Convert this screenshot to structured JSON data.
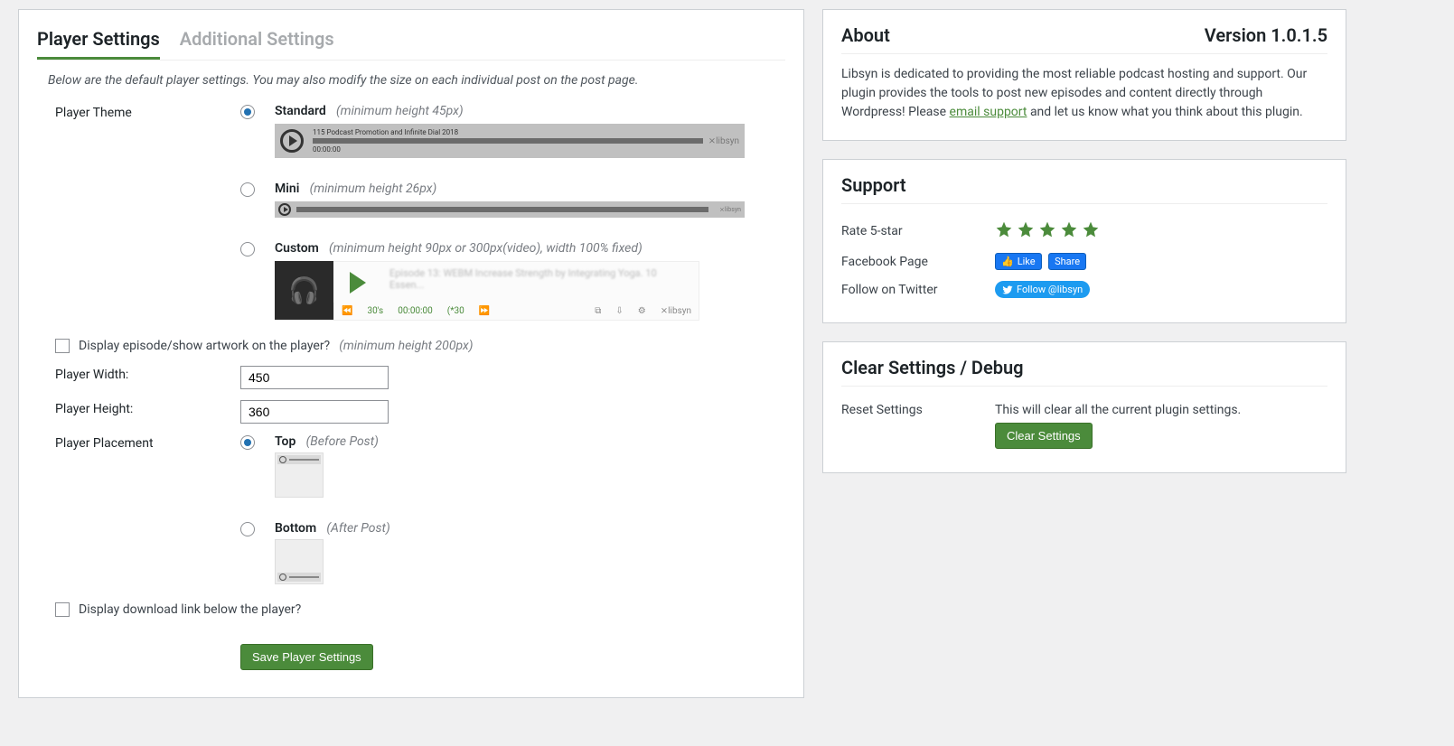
{
  "tabs": {
    "player_settings": "Player Settings",
    "additional_settings": "Additional Settings"
  },
  "intro": "Below are the default player settings. You may also modify the size on each individual post on the post page.",
  "player_theme": {
    "label": "Player Theme",
    "standard": {
      "label": "Standard",
      "note": "(minimum height 45px)",
      "track_title": "115 Podcast Promotion and Infinite Dial 2018",
      "time": "00:00:00"
    },
    "mini": {
      "label": "Mini",
      "note": "(minimum height 26px)"
    },
    "custom": {
      "label": "Custom",
      "note": "(minimum height 90px or 300px(video), width 100% fixed)",
      "blur_text": "Episode 13: WEBM Increase Strength by Integrating Yoga. 10 Essen...",
      "t1": "30's",
      "t2": "00:00:00",
      "t3": "(*30"
    }
  },
  "artwork_checkbox": {
    "label": "Display episode/show artwork on the player?",
    "note": "(minimum height 200px)"
  },
  "player_width": {
    "label": "Player Width:",
    "value": "450"
  },
  "player_height": {
    "label": "Player Height:",
    "value": "360"
  },
  "player_placement": {
    "label": "Player Placement",
    "top": {
      "label": "Top",
      "note": "(Before Post)"
    },
    "bottom": {
      "label": "Bottom",
      "note": "(After Post)"
    }
  },
  "download_checkbox": {
    "label": "Display download link below the player?"
  },
  "save_button": "Save Player Settings",
  "libsyn_brand": "⨯libsyn",
  "about": {
    "title": "About",
    "version": "Version 1.0.1.5",
    "text_before": "Libsyn is dedicated to providing the most reliable podcast hosting and support. Our plugin provides the tools to post new episodes and content directly through Wordpress! Please ",
    "link": "email support",
    "text_after": " and let us know what you think about this plugin."
  },
  "support": {
    "title": "Support",
    "rate": "Rate 5-star",
    "facebook": "Facebook Page",
    "twitter": "Follow on Twitter",
    "fb_like": "Like",
    "fb_share": "Share",
    "tw_follow": "Follow @libsyn"
  },
  "debug": {
    "title": "Clear Settings / Debug",
    "reset_label": "Reset Settings",
    "reset_desc": "This will clear all the current plugin settings.",
    "clear_button": "Clear Settings"
  }
}
